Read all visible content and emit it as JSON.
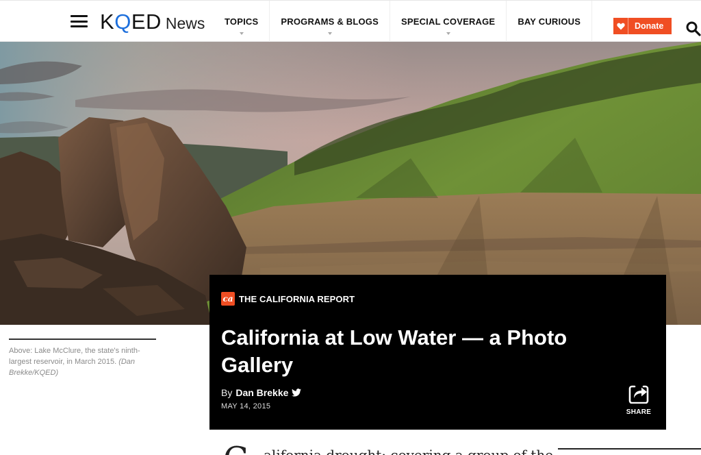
{
  "header": {
    "logo_main": "KQED",
    "logo_sub": "News",
    "nav": [
      "TOPICS",
      "PROGRAMS & BLOGS",
      "SPECIAL COVERAGE",
      "BAY CURIOUS"
    ],
    "donate_label": "Donate"
  },
  "hero": {
    "caption_text": "Above: Lake McClure, the state's ninth-largest reservoir, in March 2015.",
    "caption_credit": "(Dan Brekke/KQED)"
  },
  "article": {
    "program": "THE CALIFORNIA REPORT",
    "program_badge": "ca",
    "title": "California at Low Water — a Photo Gallery",
    "by_label": "By",
    "author": "Dan Brekke",
    "date": "MAY 14, 2015",
    "share_label": "SHARE",
    "dropcap": "C",
    "body_start": "alifornia drought: covering a group of the"
  },
  "colors": {
    "brand_orange": "#f04e23",
    "card_bg": "#000000",
    "logo_q": "#1d6fdc"
  },
  "icons": [
    "menu-icon",
    "heart-icon",
    "search-icon",
    "twitter-icon",
    "share-icon"
  ]
}
